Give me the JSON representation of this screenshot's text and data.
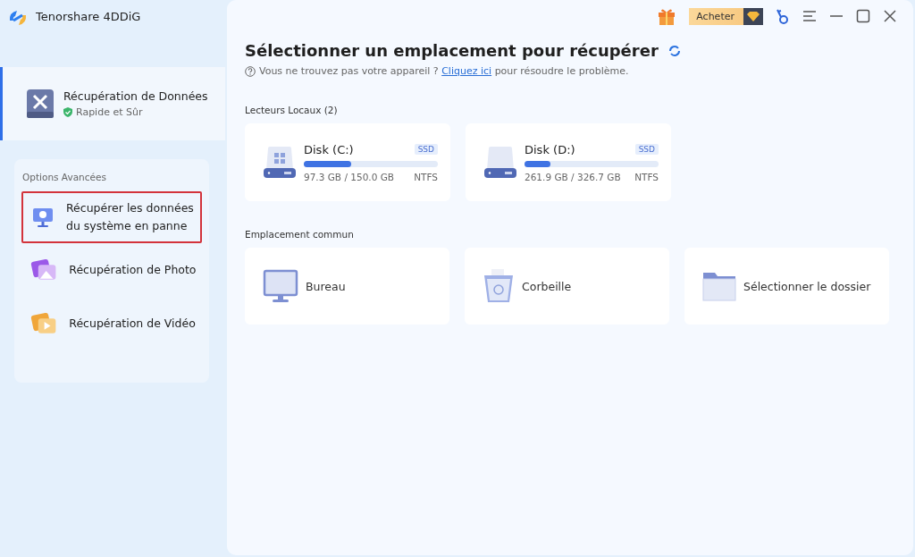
{
  "app": {
    "name": "Tenorshare 4DDiG"
  },
  "sidebar": {
    "main_item": {
      "title": "Récupération de Données",
      "subtitle": "Rapide et Sûr",
      "selected": true
    },
    "section_title": "Options Avancées",
    "items": [
      {
        "kind": "system",
        "label": "Récupérer les données du système en panne",
        "highlighted": true
      },
      {
        "kind": "photo",
        "label": "Récupération de Photo",
        "highlighted": false
      },
      {
        "kind": "video",
        "label": "Récupération de Vidéo",
        "highlighted": false
      }
    ]
  },
  "toolbar": {
    "buy_label": "Acheter"
  },
  "main": {
    "title": "Sélectionner un emplacement pour récupérer",
    "hint": {
      "before": "Vous ne trouvez pas votre appareil ?",
      "link": "Cliquez ici",
      "after": "pour résoudre le problème."
    },
    "local_drives": {
      "title": "Lecteurs Locaux (2)",
      "drives": [
        {
          "kind": "windows",
          "name": "Disk (C:)",
          "type": "SSD",
          "level": 0.35,
          "usage": "97.3 GB / 150.0 GB",
          "fs": "NTFS"
        },
        {
          "kind": "plain",
          "name": "Disk (D:)",
          "type": "SSD",
          "level": 0.19,
          "usage": "261.9 GB / 326.7 GB",
          "fs": "NTFS"
        }
      ]
    },
    "common": {
      "title": "Emplacement commun",
      "locations": [
        {
          "kind": "desktop",
          "label": "Bureau"
        },
        {
          "kind": "trash",
          "label": "Corbeille"
        },
        {
          "kind": "folder",
          "label": "Sélectionner le dossier"
        }
      ]
    }
  }
}
